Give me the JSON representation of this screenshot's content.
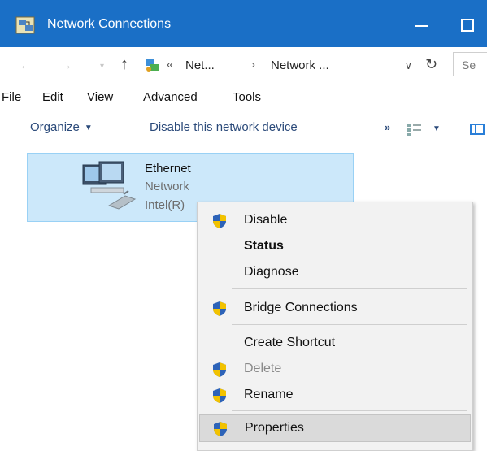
{
  "window": {
    "title": "Network Connections",
    "title_bar_color": "#1a6fc6"
  },
  "address": {
    "chevron": "«",
    "segment1": "Net...",
    "separator": "›",
    "segment2": "Network ...",
    "search_placeholder": "Se"
  },
  "menubar": {
    "items": [
      "File",
      "Edit",
      "View",
      "Advanced",
      "Tools"
    ]
  },
  "toolbar": {
    "organize": "Organize",
    "disable_device": "Disable this network device",
    "more": "»"
  },
  "connection": {
    "name": "Ethernet",
    "status": "Network",
    "adapter": "Intel(R)",
    "selection_color": "#cce8fa"
  },
  "context_menu": {
    "items": [
      {
        "label": "Disable",
        "shield": true,
        "bold": false,
        "disabled": false
      },
      {
        "label": "Status",
        "shield": false,
        "bold": true,
        "disabled": false
      },
      {
        "label": "Diagnose",
        "shield": false,
        "bold": false,
        "disabled": false
      },
      {
        "label": "Bridge Connections",
        "shield": true,
        "bold": false,
        "disabled": false
      },
      {
        "label": "Create Shortcut",
        "shield": false,
        "bold": false,
        "disabled": false
      },
      {
        "label": "Delete",
        "shield": true,
        "bold": false,
        "disabled": true
      },
      {
        "label": "Rename",
        "shield": true,
        "bold": false,
        "disabled": false
      },
      {
        "label": "Properties",
        "shield": true,
        "bold": false,
        "disabled": false,
        "highlighted": true
      }
    ]
  },
  "icons": {
    "app": "network-connections-icon",
    "shield": "uac-shield-icon",
    "refresh": "refresh-icon",
    "up": "up-arrow-icon"
  }
}
